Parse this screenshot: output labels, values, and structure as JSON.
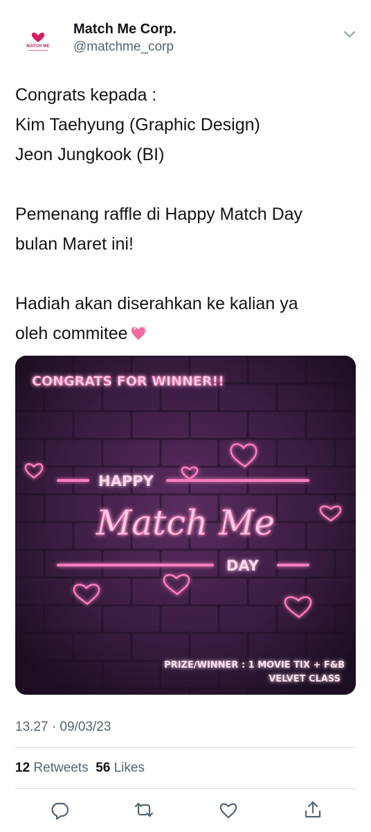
{
  "account": {
    "display_name": "Match Me Corp.",
    "handle": "@matchme_corp",
    "logo_text": "MATCH ME"
  },
  "tweet": {
    "lines": [
      "Congrats kepada :",
      "Kim Taehyung (Graphic Design)",
      "Jeon Jungkook (BI)",
      "",
      "Pemenang raffle di Happy Match Day",
      "bulan Maret ini!",
      "",
      "Hadiah akan diserahkan ke kalian ya",
      "oleh commitee"
    ]
  },
  "image": {
    "headline": "CONGRATS FOR WINNER!!",
    "happy": "HAPPY",
    "script_title": "Match Me",
    "day": "DAY",
    "prize_line1": "PRIZE/WINNER : 1 MOVIE TIX + F&B",
    "prize_line2": "VELVET CLASS"
  },
  "meta": {
    "timestamp": "13.27 · 09/03/23",
    "retweets_count": "12",
    "retweets_label": "Retweets",
    "likes_count": "56",
    "likes_label": "Likes"
  },
  "icons": [
    "more-chevron-icon",
    "reply-icon",
    "retweet-icon",
    "like-icon",
    "share-icon",
    "sparkling-heart-emoji"
  ],
  "colors": {
    "neon_pink": "#ff4fa3",
    "text_secondary": "#536471",
    "divider": "#cfd9de"
  }
}
